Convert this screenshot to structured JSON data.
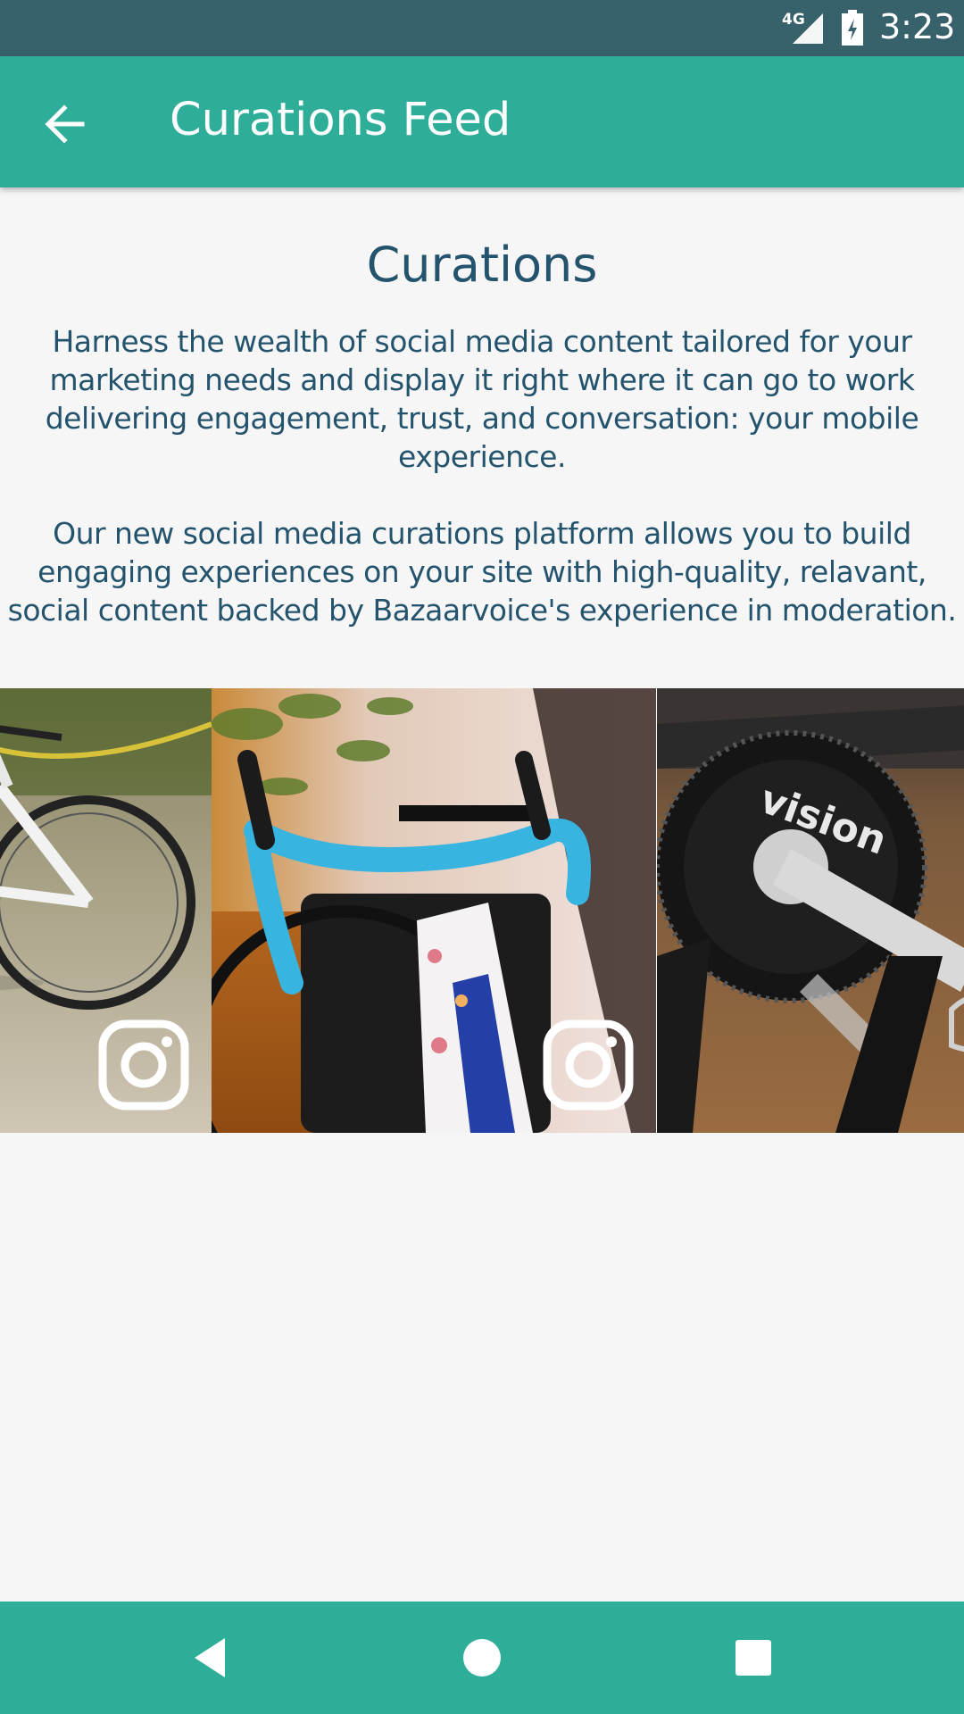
{
  "status_bar": {
    "network": "4G",
    "time": "3:23"
  },
  "app_bar": {
    "title": "Curations Feed",
    "back_icon": "arrow-left-icon"
  },
  "content": {
    "heading": "Curations",
    "description": "Harness the wealth of social media content tailored for your\nmarketing needs and display it right where it can go to work\ndelivering engagement, trust, and conversation: your mobile\nexperience.\n\nOur new social media curations platform allows you to build\nengaging experiences on your site with high-quality, relavant,\nsocial content backed by Bazaarvoice's experience in moderation."
  },
  "carousel": {
    "items": [
      {
        "subject": "white bicycle on sandy ground",
        "source_icon": "instagram-icon"
      },
      {
        "subject": "road bike with blue handlebar tape",
        "source_icon": "instagram-icon"
      },
      {
        "subject": "bicycle chainring close-up",
        "source_icon": "none"
      }
    ]
  },
  "nav_bar": {
    "back_icon": "triangle-back-icon",
    "home_icon": "circle-home-icon",
    "recents_icon": "square-recents-icon"
  },
  "colors": {
    "status_bar": "#37616b",
    "accent": "#2eae98",
    "text": "#24536d",
    "background": "#f6f6f6"
  }
}
